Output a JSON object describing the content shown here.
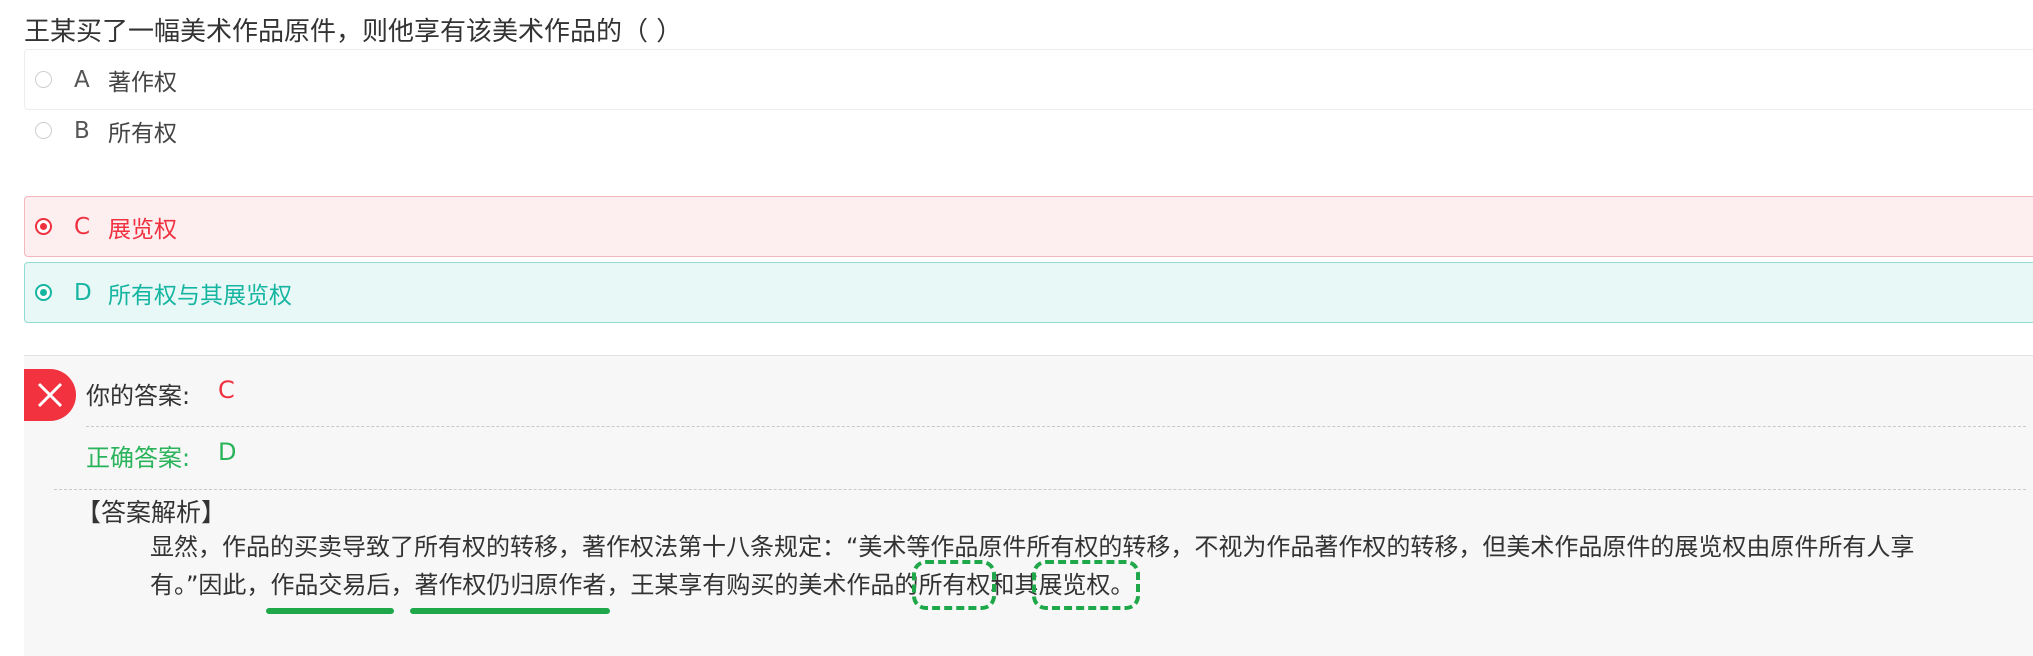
{
  "question": "王某买了一幅美术作品原件，则他享有该美术作品的（  ）",
  "options": [
    {
      "letter": "A",
      "text": "著作权",
      "state": "none"
    },
    {
      "letter": "B",
      "text": "所有权",
      "state": "none"
    },
    {
      "letter": "C",
      "text": "展览权",
      "state": "selected-wrong"
    },
    {
      "letter": "D",
      "text": "所有权与其展览权",
      "state": "correct"
    }
  ],
  "result": {
    "your_answer_label": "你的答案:",
    "your_answer_value": "C",
    "correct_answer_label": "正确答案:",
    "correct_answer_value": "D"
  },
  "analysis": {
    "title": "【答案解析】",
    "line1": "显然，作品的买卖导致了所有权的转移，著作权法第十八条规定：“美术等作品原件所有权的转移，不视为作品著作权的转移，但美术作品原件的展览权由原件所有人享",
    "line2_a": "有。”因此，",
    "line2_ul1": "作品交易后",
    "line2_b": "，",
    "line2_ul2": "著作权仍归原作者",
    "line2_c": "，王某享有购买的美术作品的",
    "line2_box1": "所有权",
    "line2_d": "和其",
    "line2_box2": "展览权。"
  },
  "colors": {
    "wrong": "#f0303f",
    "correct_option": "#16b5a2",
    "correct_answer": "#29b35a",
    "annotation": "#1fa84a"
  },
  "icons": {
    "result_badge": "close-icon"
  }
}
